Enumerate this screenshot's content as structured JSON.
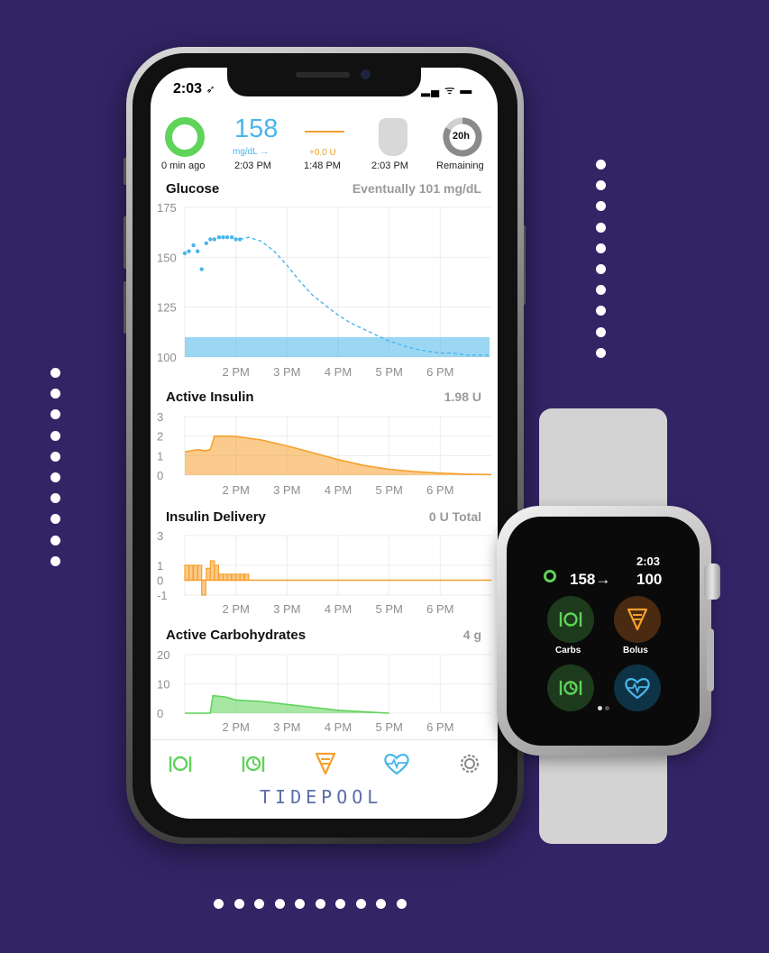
{
  "status_bar": {
    "time": "2:03",
    "location_glyph": "➶",
    "icons": "▂▄ ᯤ ▬"
  },
  "header": {
    "cgm_status": "0 min ago",
    "glucose_value": "158",
    "glucose_unit": "mg/dL →",
    "glucose_time": "2:03 PM",
    "temp_basal": "+0.0 U",
    "temp_basal_time": "1:48 PM",
    "pump_time": "2:03 PM",
    "pod_hours": "20h",
    "pod_label": "Remaining"
  },
  "sections": {
    "glucose": {
      "title": "Glucose",
      "right": "Eventually 101 mg/dL",
      "y_ticks": [
        "175",
        "150",
        "125",
        "100"
      ]
    },
    "active_insulin": {
      "title": "Active Insulin",
      "right": "1.98 U",
      "y_ticks": [
        "3",
        "2",
        "1",
        "0"
      ]
    },
    "insulin_delivery": {
      "title": "Insulin Delivery",
      "right": "0 U Total",
      "y_ticks": [
        "3",
        "1",
        "0",
        "-1"
      ]
    },
    "active_carbs": {
      "title": "Active Carbohydrates",
      "right": "4 g",
      "y_ticks": [
        "20",
        "10",
        "0"
      ]
    }
  },
  "x_ticks": [
    "2 PM",
    "3 PM",
    "4 PM",
    "5 PM",
    "6 PM"
  ],
  "tabbar": {
    "brand": "TIDEPOOL",
    "icons": [
      "carbs-icon",
      "carbs-absorbing-icon",
      "bolus-icon",
      "workout-heart-icon",
      "settings-icon"
    ]
  },
  "watch": {
    "time": "2:03",
    "glucose": "158→",
    "predicted": "100",
    "buttons": [
      {
        "label": "Carbs",
        "color": "#5fd35a"
      },
      {
        "label": "Bolus",
        "color": "#f6a02d"
      },
      {
        "label": "",
        "color": "#5fd35a"
      },
      {
        "label": "",
        "color": "#49b6e9"
      }
    ]
  },
  "colors": {
    "background": "#332466",
    "glucose": "#49b6e9",
    "insulin": "#f6a02d",
    "carbs": "#5fd35a",
    "brand": "#5d6dab"
  },
  "chart_data": [
    {
      "type": "scatter",
      "title": "Glucose",
      "ylabel": "mg/dL",
      "ylim": [
        100,
        175
      ],
      "x_ticks": [
        "2 PM",
        "3 PM",
        "4 PM",
        "5 PM",
        "6 PM"
      ],
      "target_range": [
        100,
        110
      ],
      "series": [
        {
          "points": [
            [
              1.0,
              152
            ],
            [
              1.08,
              153
            ],
            [
              1.17,
              156
            ],
            [
              1.25,
              153
            ],
            [
              1.33,
              144
            ],
            [
              1.42,
              157
            ],
            [
              1.5,
              159
            ],
            [
              1.58,
              159
            ],
            [
              1.67,
              160
            ],
            [
              1.75,
              160
            ],
            [
              1.83,
              160
            ],
            [
              1.92,
              160
            ],
            [
              2.0,
              159
            ],
            [
              2.08,
              159
            ]
          ]
        },
        {
          "style": "dashed",
          "points": [
            [
              2.08,
              159
            ],
            [
              2.25,
              160
            ],
            [
              2.5,
              158
            ],
            [
              2.75,
              153
            ],
            [
              3.0,
              146
            ],
            [
              3.25,
              138
            ],
            [
              3.5,
              131
            ],
            [
              3.75,
              126
            ],
            [
              4.0,
              121
            ],
            [
              4.25,
              117
            ],
            [
              4.5,
              114
            ],
            [
              4.75,
              111
            ],
            [
              5.0,
              108
            ],
            [
              5.25,
              106
            ],
            [
              5.5,
              104
            ],
            [
              5.75,
              103
            ],
            [
              6.0,
              102
            ],
            [
              6.25,
              102
            ],
            [
              6.5,
              101
            ],
            [
              7.0,
              101
            ]
          ]
        }
      ]
    },
    {
      "type": "area",
      "title": "Active Insulin",
      "ylim": [
        0,
        3
      ],
      "x_ticks": [
        "2 PM",
        "3 PM",
        "4 PM",
        "5 PM",
        "6 PM"
      ],
      "series": [
        {
          "points": [
            [
              1.0,
              1.2
            ],
            [
              1.25,
              1.3
            ],
            [
              1.4,
              1.25
            ],
            [
              1.5,
              1.3
            ],
            [
              1.58,
              2.0
            ],
            [
              1.8,
              2.0
            ],
            [
              2.0,
              1.98
            ],
            [
              2.5,
              1.8
            ],
            [
              3.0,
              1.5
            ],
            [
              3.5,
              1.15
            ],
            [
              4.0,
              0.8
            ],
            [
              4.5,
              0.5
            ],
            [
              5.0,
              0.3
            ],
            [
              5.5,
              0.18
            ],
            [
              6.0,
              0.1
            ],
            [
              6.5,
              0.05
            ],
            [
              7.0,
              0.03
            ]
          ]
        }
      ]
    },
    {
      "type": "bar",
      "title": "Insulin Delivery",
      "ylim": [
        -1,
        3
      ],
      "x_ticks": [
        "2 PM",
        "3 PM",
        "4 PM",
        "5 PM",
        "6 PM"
      ],
      "series": [
        {
          "points": [
            [
              1.0,
              1.0
            ],
            [
              1.08,
              1.0
            ],
            [
              1.17,
              1.0
            ],
            [
              1.25,
              1.0
            ],
            [
              1.33,
              -1.0
            ],
            [
              1.42,
              0.8
            ],
            [
              1.5,
              1.3
            ],
            [
              1.58,
              1.0
            ],
            [
              1.67,
              0.4
            ],
            [
              1.75,
              0.4
            ],
            [
              1.83,
              0.4
            ],
            [
              1.92,
              0.4
            ],
            [
              2.0,
              0.4
            ],
            [
              2.08,
              0.4
            ],
            [
              2.17,
              0.4
            ]
          ]
        }
      ],
      "basal_line": 0
    },
    {
      "type": "area",
      "title": "Active Carbohydrates",
      "ylim": [
        0,
        20
      ],
      "x_ticks": [
        "2 PM",
        "3 PM",
        "4 PM",
        "5 PM",
        "6 PM"
      ],
      "series": [
        {
          "points": [
            [
              1.0,
              0
            ],
            [
              1.5,
              0
            ],
            [
              1.55,
              6
            ],
            [
              1.8,
              5.5
            ],
            [
              2.0,
              4.5
            ],
            [
              2.5,
              4
            ],
            [
              3.0,
              3
            ],
            [
              3.5,
              2
            ],
            [
              4.0,
              1
            ],
            [
              4.5,
              0.5
            ],
            [
              5.0,
              0
            ]
          ]
        }
      ]
    }
  ]
}
